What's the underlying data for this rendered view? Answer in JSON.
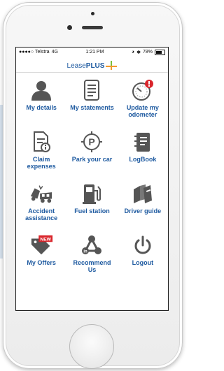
{
  "status_bar": {
    "carrier": "●●●●○ Telstra",
    "network": "4G",
    "time": "1:21 PM",
    "battery": "78%"
  },
  "brand": {
    "logo_lease": "Lease",
    "logo_plus": "PLUS"
  },
  "menu": {
    "items": [
      {
        "label": "My details",
        "icon": "person-icon"
      },
      {
        "label": "My statements",
        "icon": "statement-icon"
      },
      {
        "label": "Update my odometer",
        "icon": "odometer-icon"
      },
      {
        "label": "Claim expenses",
        "icon": "claim-document-icon"
      },
      {
        "label": "Park your car",
        "icon": "parking-icon"
      },
      {
        "label": "LogBook",
        "icon": "logbook-icon"
      },
      {
        "label": "Accident assistance",
        "icon": "accident-icon"
      },
      {
        "label": "Fuel station",
        "icon": "fuel-pump-icon"
      },
      {
        "label": "Driver guide",
        "icon": "books-icon"
      },
      {
        "label": "My Offers",
        "icon": "tag-new-icon",
        "badge": "NEW"
      },
      {
        "label": "Recommend Us",
        "icon": "share-icon"
      },
      {
        "label": "Logout",
        "icon": "power-icon"
      }
    ]
  },
  "colors": {
    "brand_blue": "#1e5aa0",
    "icon_dark": "#555555",
    "alert_red": "#d9262c",
    "plus_orange": "#f29a2e",
    "plus_green": "#7cbf3a"
  }
}
